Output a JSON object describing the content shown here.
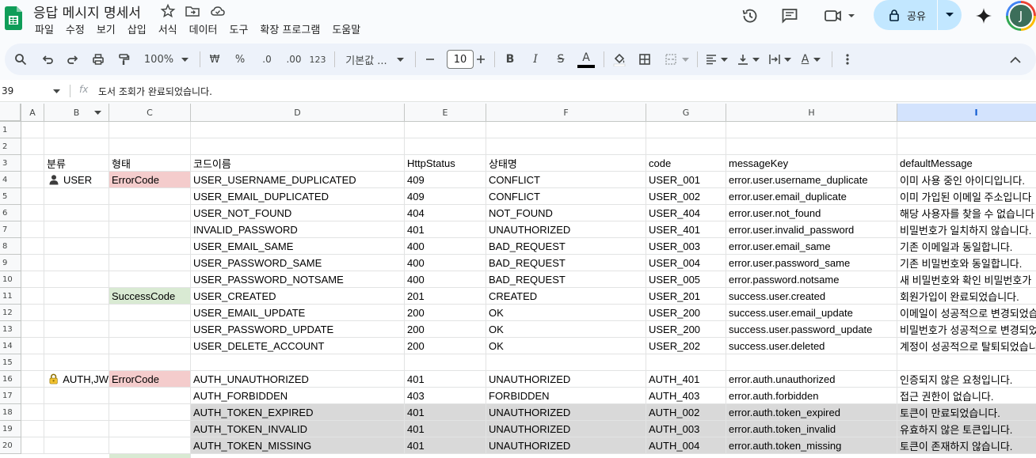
{
  "app": {
    "doc_title": "응답 메시지 명세서",
    "menu": [
      "파일",
      "수정",
      "보기",
      "삽입",
      "서식",
      "데이터",
      "도구",
      "확장 프로그램",
      "도움말"
    ],
    "share_label": "공유",
    "avatar_initial": "J"
  },
  "toolbar": {
    "zoom": "100%",
    "currency": "₩",
    "percent": "%",
    "dec_decrease": ".0",
    "dec_increase": ".00",
    "number_format": "123",
    "font_family": "기본값 ...",
    "font_size": "10",
    "bold": "B",
    "italic": "I",
    "strike": "S",
    "text_color": "A",
    "wrap": "A"
  },
  "formula_bar": {
    "name_box": "39",
    "fx": "fx",
    "content": "도서 조회가 완료되었습니다."
  },
  "columns": [
    "A",
    "B",
    "C",
    "D",
    "E",
    "F",
    "G",
    "H",
    "I"
  ],
  "rows": [
    {
      "num": "1",
      "cells": [
        "",
        "",
        "",
        "",
        "",
        "",
        "",
        "",
        ""
      ]
    },
    {
      "num": "2",
      "cells": [
        "",
        "",
        "",
        "",
        "",
        "",
        "",
        "",
        ""
      ]
    },
    {
      "num": "3",
      "cells": [
        "",
        "분류",
        "형태",
        "코드이름",
        "HttpStatus",
        "상태명",
        "code",
        "messageKey",
        "defaultMessage"
      ]
    },
    {
      "num": "4",
      "cells": [
        "",
        "USER",
        "ErrorCode",
        "USER_USERNAME_DUPLICATED",
        "409",
        "CONFLICT",
        "USER_001",
        "error.user.username_duplicate",
        "이미 사용 중인 아이디입니다."
      ]
    },
    {
      "num": "5",
      "cells": [
        "",
        "",
        "",
        "USER_EMAIL_DUPLICATED",
        "409",
        "CONFLICT",
        "USER_002",
        "error.user.email_duplicate",
        "이미 가입된 이메일 주소입니다"
      ]
    },
    {
      "num": "6",
      "cells": [
        "",
        "",
        "",
        "USER_NOT_FOUND",
        "404",
        "NOT_FOUND",
        "USER_404",
        "error.user.not_found",
        "해당 사용자를 찾을 수 없습니다"
      ]
    },
    {
      "num": "7",
      "cells": [
        "",
        "",
        "",
        "INVALID_PASSWORD",
        "401",
        "UNAUTHORIZED",
        "USER_401",
        "error.user.invalid_password",
        "비밀번호가 일치하지 않습니다."
      ]
    },
    {
      "num": "8",
      "cells": [
        "",
        "",
        "",
        "USER_EMAIL_SAME",
        "400",
        "BAD_REQUEST",
        "USER_003",
        "error.user.email_same",
        "기존 이메일과 동일합니다."
      ]
    },
    {
      "num": "9",
      "cells": [
        "",
        "",
        "",
        "USER_PASSWORD_SAME",
        "400",
        "BAD_REQUEST",
        "USER_004",
        "error.user.password_same",
        "기존 비밀번호와 동일합니다."
      ]
    },
    {
      "num": "10",
      "cells": [
        "",
        "",
        "",
        "USER_PASSWORD_NOTSAME",
        "400",
        "BAD_REQUEST",
        "USER_005",
        "error.password.notsame",
        "새 비밀번호와 확인 비밀번호가"
      ]
    },
    {
      "num": "11",
      "cells": [
        "",
        "",
        "SuccessCode",
        "USER_CREATED",
        "201",
        "CREATED",
        "USER_201",
        "success.user.created",
        "회원가입이 완료되었습니다."
      ]
    },
    {
      "num": "12",
      "cells": [
        "",
        "",
        "",
        "USER_EMAIL_UPDATE",
        "200",
        "OK",
        "USER_200",
        "success.user.email_update",
        "이메일이 성공적으로 변경되었습"
      ]
    },
    {
      "num": "13",
      "cells": [
        "",
        "",
        "",
        "USER_PASSWORD_UPDATE",
        "200",
        "OK",
        "USER_200",
        "success.user.password_update",
        "비밀번호가 성공적으로 변경되었"
      ]
    },
    {
      "num": "14",
      "cells": [
        "",
        "",
        "",
        "USER_DELETE_ACCOUNT",
        "200",
        "OK",
        "USER_202",
        "success.user.deleted",
        "계정이 성공적으로 탈퇴되었습니"
      ]
    },
    {
      "num": "15",
      "cells": [
        "",
        "",
        "",
        "",
        "",
        "",
        "",
        "",
        ""
      ]
    },
    {
      "num": "16",
      "cells": [
        "",
        "AUTH,JW",
        "ErrorCode",
        "AUTH_UNAUTHORIZED",
        "401",
        "UNAUTHORIZED",
        "AUTH_401",
        "error.auth.unauthorized",
        "인증되지 않은 요청입니다."
      ]
    },
    {
      "num": "17",
      "cells": [
        "",
        "",
        "",
        "AUTH_FORBIDDEN",
        "403",
        "FORBIDDEN",
        "AUTH_403",
        "error.auth.forbidden",
        "접근 권한이 없습니다."
      ]
    },
    {
      "num": "18",
      "cells": [
        "",
        "",
        "",
        "AUTH_TOKEN_EXPIRED",
        "401",
        "UNAUTHORIZED",
        "AUTH_002",
        "error.auth.token_expired",
        "토큰이 만료되었습니다."
      ]
    },
    {
      "num": "19",
      "cells": [
        "",
        "",
        "",
        "AUTH_TOKEN_INVALID",
        "401",
        "UNAUTHORIZED",
        "AUTH_003",
        "error.auth.token_invalid",
        "유효하지 않은 토큰입니다."
      ]
    },
    {
      "num": "20",
      "cells": [
        "",
        "",
        "",
        "AUTH_TOKEN_MISSING",
        "401",
        "UNAUTHORIZED",
        "AUTH_004",
        "error.auth.token_missing",
        "토큰이 존재하지 않습니다."
      ]
    }
  ],
  "colors": {
    "error_bg": "#f4cccc",
    "success_bg": "#d9ead3",
    "gray_bg": "#d9d9d9",
    "selected_col": "#d3e3fd",
    "share_bg": "#c2e7ff"
  }
}
